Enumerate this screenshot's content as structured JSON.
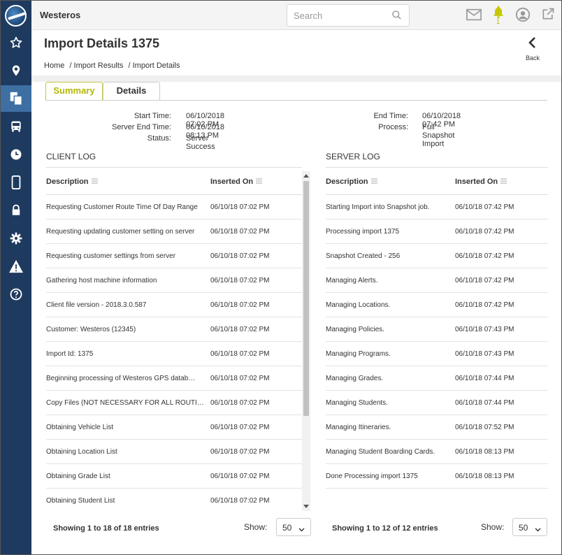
{
  "app": {
    "title": "Westeros"
  },
  "search": {
    "placeholder": "Search"
  },
  "notifications": {
    "count": "1"
  },
  "page": {
    "title": "Import Details 1375",
    "breadcrumb": [
      "Home",
      "/ Import Results",
      "/ Import Details"
    ],
    "back_label": "Back"
  },
  "tabs": [
    {
      "label": "Summary",
      "active": true
    },
    {
      "label": "Details",
      "active": false
    }
  ],
  "summary": {
    "start_time_label": "Start Time:",
    "start_time": "06/10/2018 07:02 PM",
    "server_end_time_label": "Server End Time:",
    "server_end_time": "06/10/2018 08:13 PM",
    "status_label": "Status:",
    "status": "Server Success",
    "end_time_label": "End Time:",
    "end_time": "06/10/2018 07:42 PM",
    "process_label": "Process:",
    "process": "Full Snapshot Import"
  },
  "client_log": {
    "title": "CLIENT LOG",
    "columns": [
      "Description",
      "Inserted On"
    ],
    "rows": [
      [
        "Requesting Customer Route Time Of Day Range",
        "06/10/18 07:02 PM"
      ],
      [
        "Requesting updating customer setting on server",
        "06/10/18 07:02 PM"
      ],
      [
        "Requesting customer settings from server",
        "06/10/18 07:02 PM"
      ],
      [
        "Gathering host machine information",
        "06/10/18 07:02 PM"
      ],
      [
        "Client file version - 2018.3.0.587",
        "06/10/18 07:02 PM"
      ],
      [
        "Customer: Westeros (12345)",
        "06/10/18 07:02 PM"
      ],
      [
        "Import Id: 1375",
        "06/10/18 07:02 PM"
      ],
      [
        "Beginning processing of Westeros GPS datab…",
        "06/10/18 07:02 PM"
      ],
      [
        "Copy Files (NOT NECESSARY FOR ALL ROUTING …",
        "06/10/18 07:02 PM"
      ],
      [
        "Obtaining Vehicle List",
        "06/10/18 07:02 PM"
      ],
      [
        "Obtaining Location List",
        "06/10/18 07:02 PM"
      ],
      [
        "Obtaining Grade List",
        "06/10/18 07:02 PM"
      ],
      [
        "Obtaining Student List",
        "06/10/18 07:02 PM"
      ]
    ],
    "footer": "Showing 1 to 18 of 18 entries",
    "show_label": "Show:",
    "page_size": "50"
  },
  "server_log": {
    "title": "SERVER LOG",
    "columns": [
      "Description",
      "Inserted On"
    ],
    "rows": [
      [
        "Starting Import into Snapshot job.",
        "06/10/18 07:42 PM"
      ],
      [
        "Processing import 1375",
        "06/10/18 07:42 PM"
      ],
      [
        "Snapshot Created - 256",
        "06/10/18 07:42 PM"
      ],
      [
        "Managing Alerts.",
        "06/10/18 07:42 PM"
      ],
      [
        "Managing Locations.",
        "06/10/18 07:42 PM"
      ],
      [
        "Managing Policies.",
        "06/10/18 07:43 PM"
      ],
      [
        "Managing Programs.",
        "06/10/18 07:43 PM"
      ],
      [
        "Managing Grades.",
        "06/10/18 07:44 PM"
      ],
      [
        "Managing Students.",
        "06/10/18 07:44 PM"
      ],
      [
        "Managing Itineraries.",
        "06/10/18 07:52 PM"
      ],
      [
        "Managing Student Boarding Cards.",
        "06/10/18 08:13 PM"
      ],
      [
        "Done Processing import 1375",
        "06/10/18 08:13 PM"
      ]
    ],
    "footer": "Showing 1 to 12 of 12 entries",
    "show_label": "Show:",
    "page_size": "50"
  },
  "sidebar": {
    "items": [
      {
        "icon": "star-icon"
      },
      {
        "icon": "map-pin-icon"
      },
      {
        "icon": "documents-icon",
        "active": true
      },
      {
        "icon": "bus-icon"
      },
      {
        "icon": "clock-icon"
      },
      {
        "icon": "tablet-icon"
      },
      {
        "icon": "lock-icon"
      },
      {
        "icon": "gear-icon"
      },
      {
        "icon": "warning-icon"
      },
      {
        "icon": "help-icon"
      }
    ]
  },
  "colors": {
    "sidebar": "#1e3a5f",
    "sidebar_active": "#3d6fa3",
    "accent": "#b2b800",
    "bell": "#c8c800"
  }
}
